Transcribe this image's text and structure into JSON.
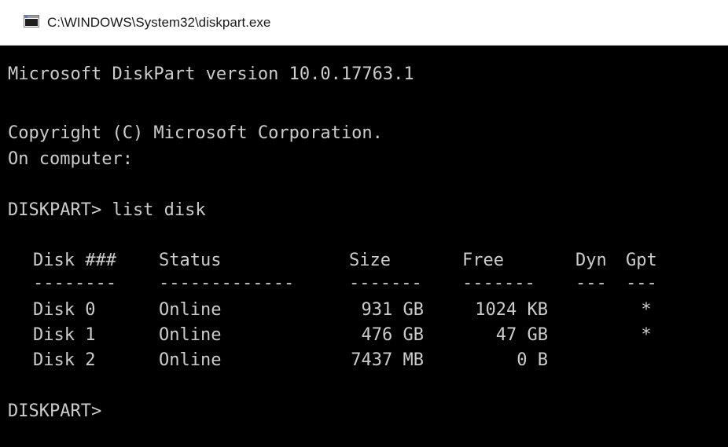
{
  "window": {
    "title": "C:\\WINDOWS\\System32\\diskpart.exe",
    "icon": "console-app-icon"
  },
  "console": {
    "version_line": "Microsoft DiskPart version 10.0.17763.1",
    "copyright_line": "Copyright (C) Microsoft Corporation.",
    "computer_line": "On computer:",
    "command_line": "DISKPART> list disk",
    "prompt_line": "DISKPART>"
  },
  "disk_table": {
    "headers": {
      "disk": "Disk ###",
      "status": "Status",
      "size": "Size",
      "free": "Free",
      "dyn": "Dyn",
      "gpt": "Gpt"
    },
    "separators": {
      "disk": "--------",
      "status": "-------------",
      "size": "-------",
      "free": "-------",
      "dyn": "---",
      "gpt": "---"
    },
    "rows": [
      {
        "disk": "Disk 0",
        "status": "Online",
        "size": "931 GB",
        "free": "1024 KB",
        "dyn": "",
        "gpt": "*"
      },
      {
        "disk": "Disk 1",
        "status": "Online",
        "size": "476 GB",
        "free": "47 GB",
        "dyn": "",
        "gpt": "*"
      },
      {
        "disk": "Disk 2",
        "status": "Online",
        "size": "7437 MB",
        "free": "0 B",
        "dyn": "",
        "gpt": ""
      }
    ]
  },
  "colors": {
    "console_background": "#000000",
    "console_text": "#cccccc",
    "titlebar_background": "#ffffff"
  }
}
